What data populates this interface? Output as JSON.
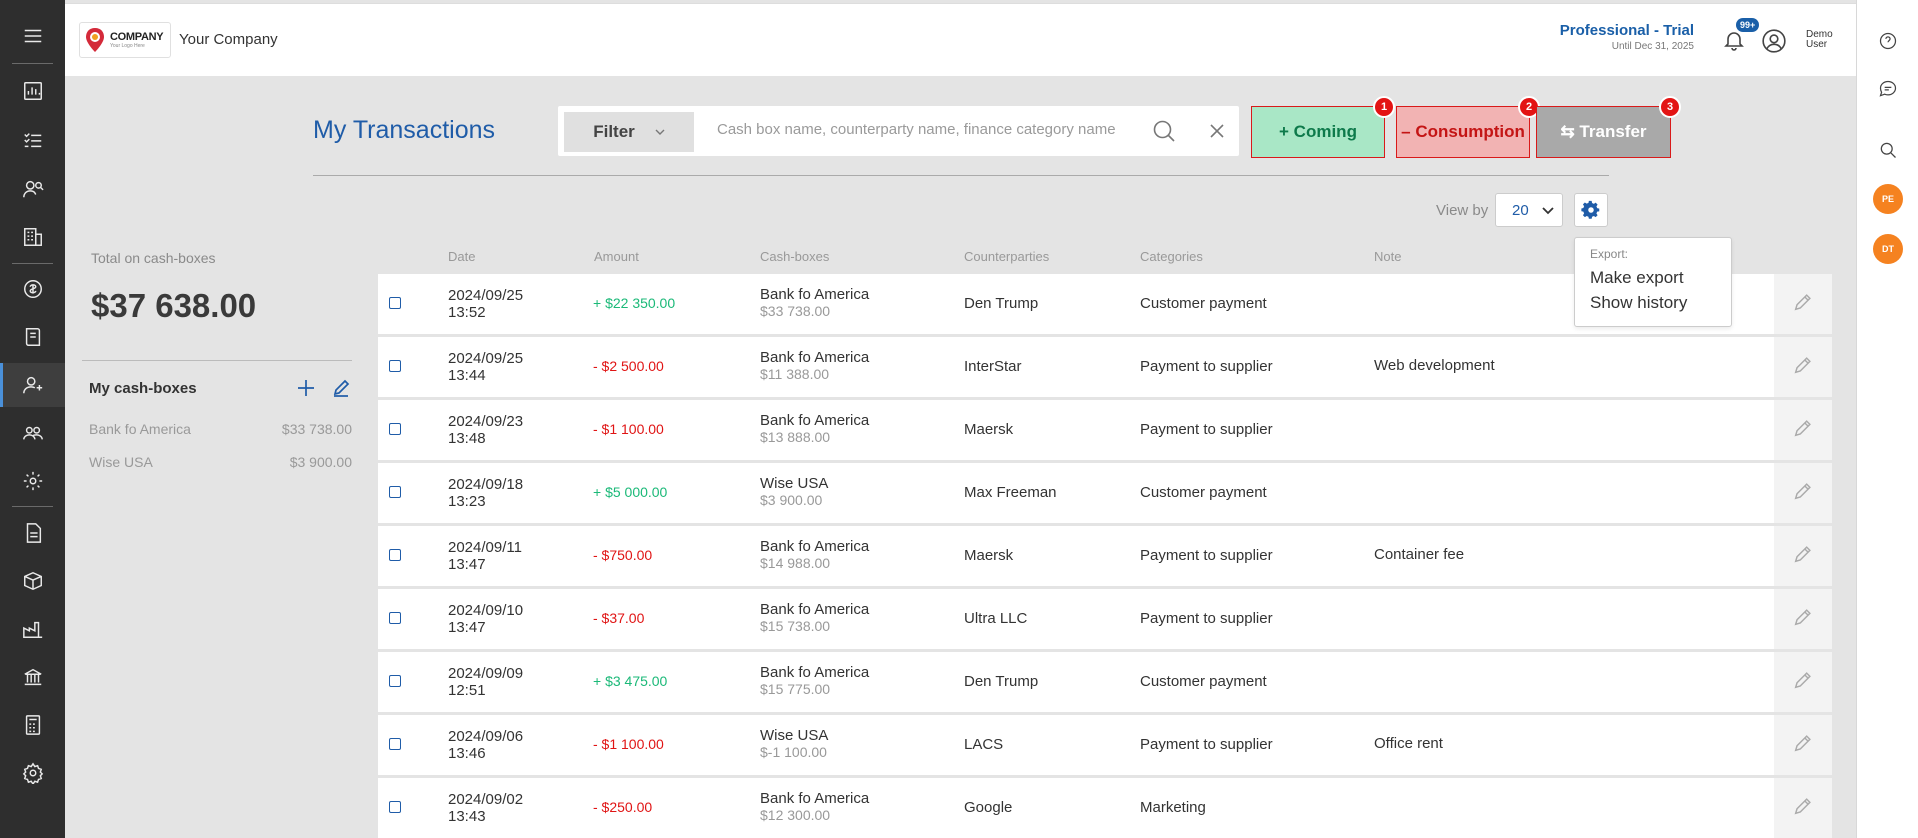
{
  "header": {
    "logo_title": "COMPANY",
    "logo_subtitle": "Your Logo Here",
    "company_name": "Your Company",
    "plan_name": "Professional - Trial",
    "plan_until": "Until Dec 31, 2025",
    "notifications_badge": "99+",
    "user_name": "Demo User"
  },
  "sidebar": {
    "icons": [
      "menu-icon",
      "dashboard-chart-icon",
      "task-list-icon",
      "users-search-icon",
      "building-icon",
      "currency-exchange-icon",
      "ledger-icon",
      "person-money-icon",
      "team-icon",
      "gear-user-icon",
      "document-icon",
      "package-icon",
      "factory-icon",
      "bank-icon",
      "calculator-icon",
      "settings-icon"
    ]
  },
  "rightrail": {
    "avatars": [
      "PE",
      "DT"
    ]
  },
  "page": {
    "title": "My Transactions",
    "filter_label": "Filter",
    "search_placeholder": "Cash box name, counterparty name, finance category name",
    "btn_coming": "+ Coming",
    "btn_consumption": "– Consumption",
    "btn_transfer": "⇆ Transfer",
    "badge_1": "1",
    "badge_2": "2",
    "badge_3": "3",
    "view_by_label": "View by",
    "view_by_value": "20"
  },
  "export_menu": {
    "header": "Export:",
    "make_export": "Make export",
    "show_history": "Show history"
  },
  "summary": {
    "total_label": "Total on cash-boxes",
    "total_value": "$37 638.00",
    "cashboxes_title": "My cash-boxes",
    "cashboxes": [
      {
        "name": "Bank fo America",
        "amount": "$33 738.00"
      },
      {
        "name": "Wise USA",
        "amount": "$3 900.00"
      }
    ]
  },
  "table": {
    "columns": {
      "date": "Date",
      "amount": "Amount",
      "cashboxes": "Cash-boxes",
      "counterparties": "Counterparties",
      "categories": "Categories",
      "note": "Note"
    },
    "rows": [
      {
        "date": "2024/09/25",
        "time": "13:52",
        "amount": "+ $22 350.00",
        "type": "pos",
        "box": "Bank fo America",
        "box_bal": "$33 738.00",
        "cp": "Den Trump",
        "cat": "Customer payment",
        "note": ""
      },
      {
        "date": "2024/09/25",
        "time": "13:44",
        "amount": "- $2 500.00",
        "type": "neg",
        "box": "Bank fo America",
        "box_bal": "$11 388.00",
        "cp": "InterStar",
        "cat": "Payment to supplier",
        "note": "Web development"
      },
      {
        "date": "2024/09/23",
        "time": "13:48",
        "amount": "- $1 100.00",
        "type": "neg",
        "box": "Bank fo America",
        "box_bal": "$13 888.00",
        "cp": "Maersk",
        "cat": "Payment to supplier",
        "note": ""
      },
      {
        "date": "2024/09/18",
        "time": "13:23",
        "amount": "+ $5 000.00",
        "type": "pos",
        "box": "Wise USA",
        "box_bal": "$3 900.00",
        "cp": "Max Freeman",
        "cat": "Customer payment",
        "note": ""
      },
      {
        "date": "2024/09/11",
        "time": "13:47",
        "amount": "- $750.00",
        "type": "neg",
        "box": "Bank fo America",
        "box_bal": "$14 988.00",
        "cp": "Maersk",
        "cat": "Payment to supplier",
        "note": "Container fee"
      },
      {
        "date": "2024/09/10",
        "time": "13:47",
        "amount": "- $37.00",
        "type": "neg",
        "box": "Bank fo America",
        "box_bal": "$15 738.00",
        "cp": "Ultra LLC",
        "cat": "Payment to supplier",
        "note": ""
      },
      {
        "date": "2024/09/09",
        "time": "12:51",
        "amount": "+ $3 475.00",
        "type": "pos",
        "box": "Bank fo America",
        "box_bal": "$15 775.00",
        "cp": "Den Trump",
        "cat": "Customer payment",
        "note": ""
      },
      {
        "date": "2024/09/06",
        "time": "13:46",
        "amount": "- $1 100.00",
        "type": "neg",
        "box": "Wise USA",
        "box_bal": "$-1 100.00",
        "cp": "LACS",
        "cat": "Payment to supplier",
        "note": "Office rent"
      },
      {
        "date": "2024/09/02",
        "time": "13:43",
        "amount": "- $250.00",
        "type": "neg",
        "box": "Bank fo America",
        "box_bal": "$12 300.00",
        "cp": "Google",
        "cat": "Marketing",
        "note": ""
      }
    ]
  }
}
